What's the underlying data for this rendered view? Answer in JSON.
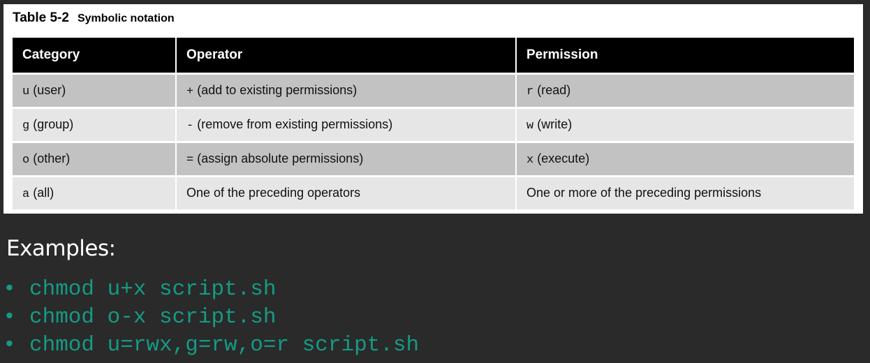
{
  "table": {
    "caption_label": "Table 5-2",
    "caption_title": "Symbolic notation",
    "headers": [
      "Category",
      "Operator",
      "Permission"
    ],
    "rows": [
      {
        "category_code": "u",
        "category_text": " (user)",
        "operator_code": "+",
        "operator_text": " (add to existing permissions)",
        "permission_code": "r",
        "permission_text": " (read)"
      },
      {
        "category_code": "g",
        "category_text": " (group)",
        "operator_code": "-",
        "operator_text": " (remove from existing permissions)",
        "permission_code": "w",
        "permission_text": " (write)"
      },
      {
        "category_code": "o",
        "category_text": " (other)",
        "operator_code": "=",
        "operator_text": " (assign absolute permissions)",
        "permission_code": "x",
        "permission_text": " (execute)"
      },
      {
        "category_code": "a",
        "category_text": " (all)",
        "operator_code": "",
        "operator_text": "One of the preceding operators",
        "permission_code": "",
        "permission_text": "One or more of the preceding permissions"
      }
    ]
  },
  "examples": {
    "heading": "Examples:",
    "bullet": "•",
    "items": [
      "chmod u+x script.sh",
      "chmod o-x script.sh",
      "chmod u=rwx,g=rw,o=r script.sh"
    ]
  },
  "colors": {
    "background": "#2a2a2a",
    "header_fill": "#000000",
    "row_shade": "#c2c2c2",
    "row_light": "#e6e6e6",
    "example_code": "#159b84"
  }
}
